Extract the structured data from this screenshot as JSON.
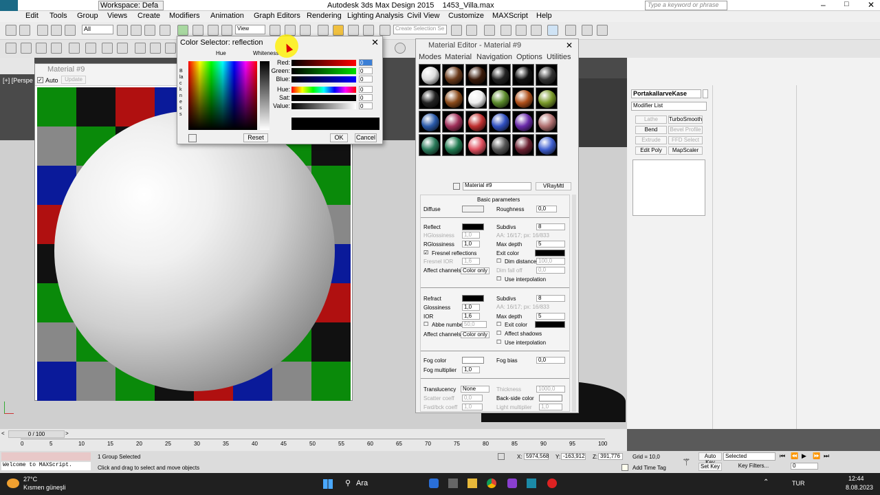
{
  "window": {
    "app_title": "Autodesk 3ds Max Design 2015",
    "file": "1453_Villa.max",
    "workspace": "Workspace: Defa",
    "search_placeholder": "Type a keyword or phrase"
  },
  "menubar": [
    "Edit",
    "Tools",
    "Group",
    "Views",
    "Create",
    "Modifiers",
    "Animation",
    "Graph Editors",
    "Rendering",
    "Lighting Analysis",
    "Civil View",
    "Customize",
    "MAXScript",
    "Help"
  ],
  "toolbar": {
    "selection_filter": "All",
    "ref_coord": "View",
    "selection_set_placeholder": "Create Selection Se"
  },
  "material_window": {
    "title": "Material #9",
    "auto_label": "Auto",
    "update_label": "Update"
  },
  "viewport": {
    "label": "[+] [Perspe"
  },
  "color_selector": {
    "title": "Color Selector: reflection",
    "hue_header": "Hue",
    "whiteness_header": "Whiteness",
    "blackness_label": "Blackness",
    "rows": [
      {
        "label": "Red:",
        "value": "0"
      },
      {
        "label": "Green:",
        "value": "0"
      },
      {
        "label": "Blue:",
        "value": "0"
      },
      {
        "label": "Hue:",
        "value": "0"
      },
      {
        "label": "Sat:",
        "value": "0"
      },
      {
        "label": "Value:",
        "value": "0"
      }
    ],
    "reset": "Reset",
    "ok": "OK",
    "cancel": "Cancel"
  },
  "material_editor": {
    "title": "Material Editor - Material #9",
    "menu": [
      "Modes",
      "Material",
      "Navigation",
      "Options",
      "Utilities"
    ],
    "material_name": "Material #9",
    "material_type": "VRayMtl",
    "rollout": "Basic parameters",
    "diffuse": "Diffuse",
    "roughness": "Roughness",
    "roughness_val": "0,0",
    "reflect": "Reflect",
    "subdivs": "Subdivs",
    "subdivs_val": "8",
    "hglossiness": "HGlossiness",
    "hgloss_val": "1,0",
    "aa_text": "AA: 16/17; px: 16/833",
    "rglossiness": "RGlossiness",
    "rgloss_val": "1,0",
    "max_depth": "Max depth",
    "max_depth_val": "5",
    "fresnel": "Fresnel reflections",
    "exit_color": "Exit color",
    "fresnel_ior": "Fresnel IOR",
    "fresnel_ior_val": "1,6",
    "dim_distance": "Dim distance",
    "dim_distance_val": "100,0",
    "dim_falloff": "Dim fall off",
    "dim_falloff_val": "0,0",
    "affect_channels": "Affect channels",
    "color_only": "Color only",
    "use_interpolation": "Use interpolation",
    "refract": "Refract",
    "glossiness": "Glossiness",
    "gloss_val": "1,0",
    "ior": "IOR",
    "ior_val": "1,6",
    "abbe": "Abbe number",
    "abbe_val": "50,0",
    "affect_shadows": "Affect shadows",
    "fog_color": "Fog color",
    "fog_bias": "Fog bias",
    "fog_bias_val": "0,0",
    "fog_multiplier": "Fog multiplier",
    "fog_mult_val": "1,0",
    "translucency": "Translucency",
    "translucency_val": "None",
    "thickness": "Thickness",
    "thickness_val": "1000,0",
    "scatter": "Scatter coeff",
    "scatter_val": "0,0",
    "backside": "Back-side color",
    "fwdbck": "Fwd/bck coeff",
    "fwdbck_val": "1,0",
    "light_mult": "Light multiplier",
    "light_mult_val": "1,0"
  },
  "command_panel": {
    "object_name": "PortakallarveKase",
    "modifier_list": "Modifier List",
    "buttons": [
      "Lathe",
      "TurboSmooth",
      "Bend",
      "Bevel Profile",
      "Extrude",
      "FFD Select",
      "Edit Poly",
      "MapScaler"
    ]
  },
  "timeline": {
    "frame": "0 / 100",
    "ticks": [
      "0",
      "5",
      "10",
      "15",
      "20",
      "25",
      "30",
      "35",
      "40",
      "45",
      "50",
      "55",
      "60",
      "65",
      "70",
      "75",
      "80",
      "85",
      "90",
      "95",
      "100"
    ]
  },
  "status": {
    "maxscript": "Welcome to MAXScript.",
    "selected": "1 Group Selected",
    "prompt": "Click and drag to select and move objects",
    "x": "5974,568",
    "y": "-163,912",
    "z": "391,776",
    "grid": "Grid = 10,0",
    "add_time_tag": "Add Time Tag",
    "auto_key": "Auto Key",
    "set_key": "Set Key",
    "selected_dropdown": "Selected",
    "key_filters": "Key Filters...",
    "frame_field": "0"
  },
  "taskbar": {
    "temp": "27°C",
    "weather": "Kısmen güneşli",
    "search": "Ara",
    "lang": "TUR",
    "time": "12:44",
    "date": "8.08.2023"
  }
}
